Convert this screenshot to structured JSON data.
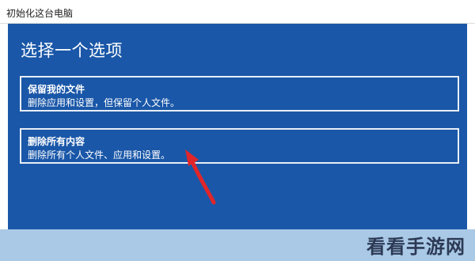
{
  "window": {
    "title": "初始化这台电脑"
  },
  "dialog": {
    "heading": "选择一个选项",
    "options": [
      {
        "title": "保留我的文件",
        "description": "删除应用和设置，但保留个人文件。"
      },
      {
        "title": "删除所有内容",
        "description": "删除所有个人文件、应用和设置。"
      }
    ]
  },
  "annotation": {
    "arrow_color": "#e0262a",
    "arrow_points_to": "删除所有内容"
  },
  "colors": {
    "dialog_background": "#1a57a8",
    "bottom_band": "#a9c9e6"
  },
  "watermark": {
    "text": "看看手游网"
  }
}
